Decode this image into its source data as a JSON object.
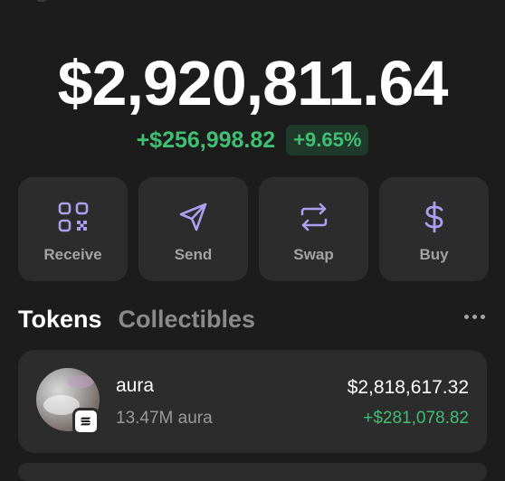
{
  "wallet": {
    "balance": "$2,920,811.64",
    "change_amount": "+$256,998.82",
    "change_percent": "+9.65%"
  },
  "actions": [
    {
      "label": "Receive",
      "icon": "qr-code-icon"
    },
    {
      "label": "Send",
      "icon": "paper-plane-icon"
    },
    {
      "label": "Swap",
      "icon": "swap-arrows-icon"
    },
    {
      "label": "Buy",
      "icon": "dollar-icon"
    }
  ],
  "tabs": {
    "tokens": "Tokens",
    "collectibles": "Collectibles"
  },
  "tokens": [
    {
      "name": "aura",
      "quantity": "13.47M aura",
      "value": "$2,818,617.32",
      "change": "+$281,078.82"
    }
  ],
  "colors": {
    "background": "#1c1c1c",
    "card": "#2c2c2c",
    "accent": "#ab9ff2",
    "positive": "#3fbf74"
  }
}
